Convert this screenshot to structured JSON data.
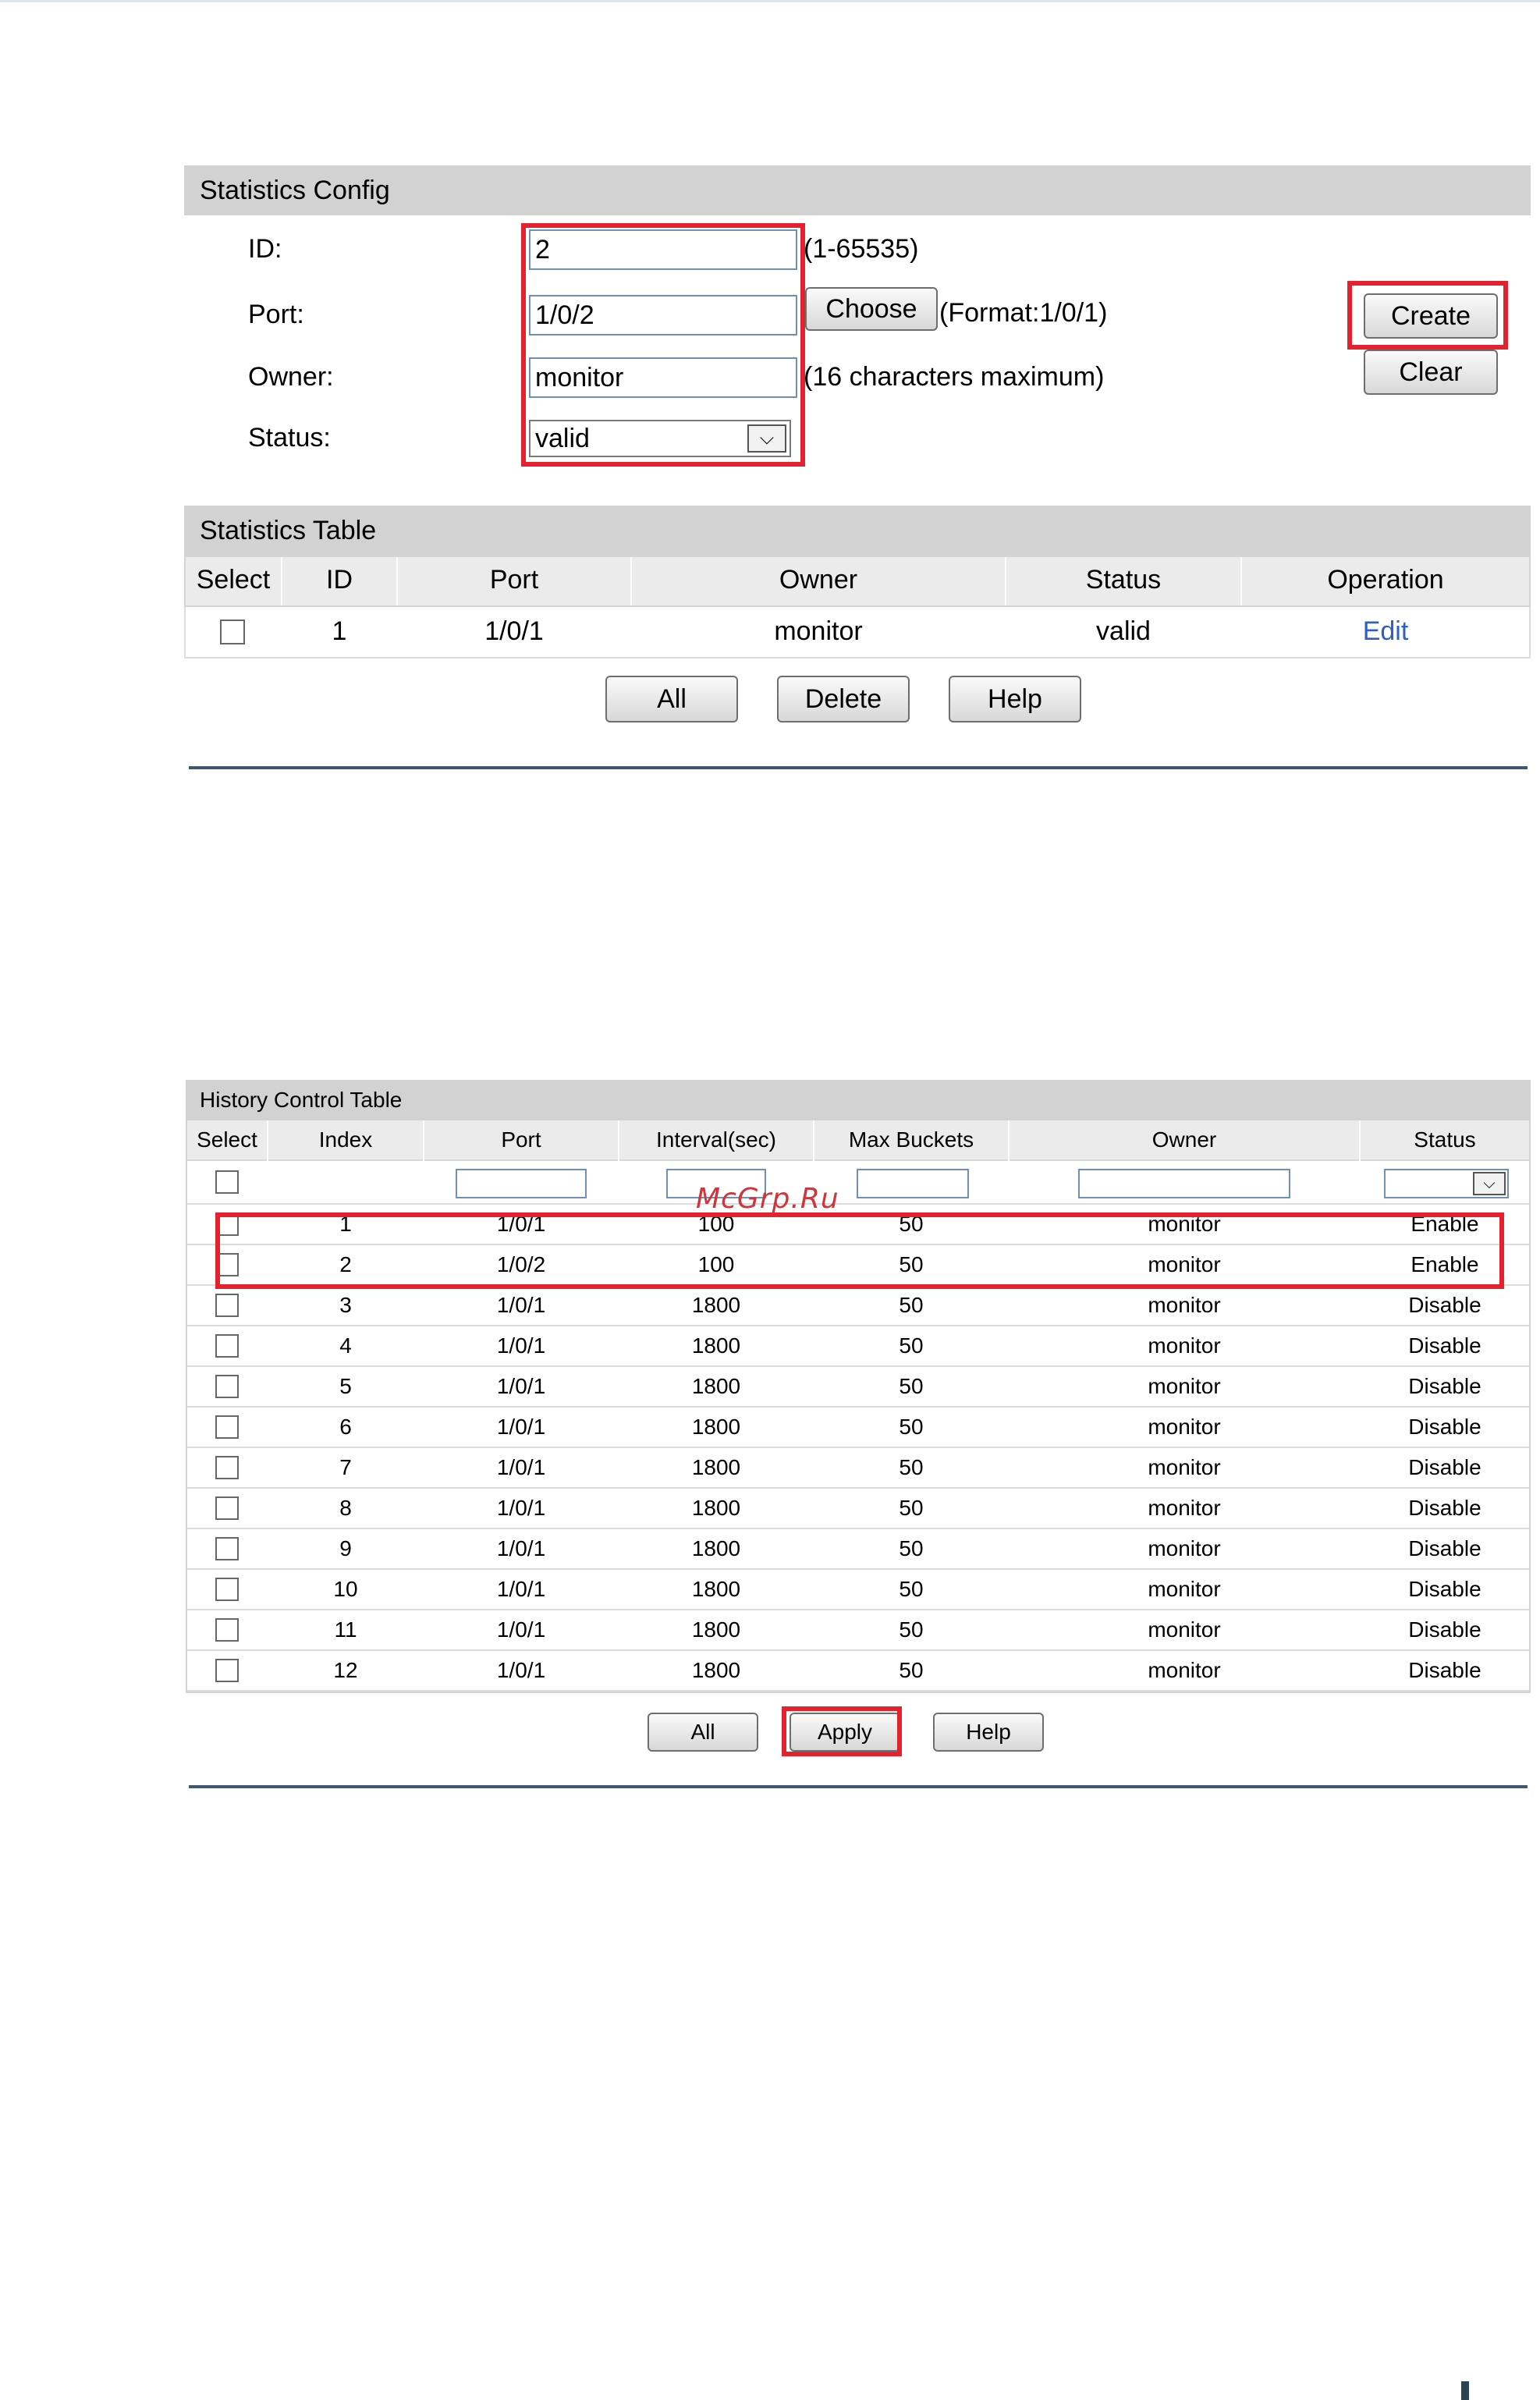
{
  "statistics_config": {
    "header": "Statistics Config",
    "id_label": "ID:",
    "id_value": "2",
    "id_hint": "(1-65535)",
    "port_label": "Port:",
    "port_value": "1/0/2",
    "choose_label": "Choose",
    "port_hint": "(Format:1/0/1)",
    "owner_label": "Owner:",
    "owner_value": "monitor",
    "owner_hint": "(16 characters maximum)",
    "status_label": "Status:",
    "status_value": "valid",
    "create_label": "Create",
    "clear_label": "Clear"
  },
  "statistics_table": {
    "header": "Statistics Table",
    "columns": [
      "Select",
      "ID",
      "Port",
      "Owner",
      "Status",
      "Operation"
    ],
    "rows": [
      {
        "id": "1",
        "port": "1/0/1",
        "owner": "monitor",
        "status": "valid",
        "operation": "Edit"
      }
    ],
    "buttons": {
      "all": "All",
      "delete": "Delete",
      "help": "Help"
    }
  },
  "history_control_table": {
    "header": "History Control Table",
    "columns": [
      "Select",
      "Index",
      "Port",
      "Interval(sec)",
      "Max Buckets",
      "Owner",
      "Status"
    ],
    "rows": [
      {
        "index": "1",
        "port": "1/0/1",
        "interval": "100",
        "buckets": "50",
        "owner": "monitor",
        "status": "Enable"
      },
      {
        "index": "2",
        "port": "1/0/2",
        "interval": "100",
        "buckets": "50",
        "owner": "monitor",
        "status": "Enable"
      },
      {
        "index": "3",
        "port": "1/0/1",
        "interval": "1800",
        "buckets": "50",
        "owner": "monitor",
        "status": "Disable"
      },
      {
        "index": "4",
        "port": "1/0/1",
        "interval": "1800",
        "buckets": "50",
        "owner": "monitor",
        "status": "Disable"
      },
      {
        "index": "5",
        "port": "1/0/1",
        "interval": "1800",
        "buckets": "50",
        "owner": "monitor",
        "status": "Disable"
      },
      {
        "index": "6",
        "port": "1/0/1",
        "interval": "1800",
        "buckets": "50",
        "owner": "monitor",
        "status": "Disable"
      },
      {
        "index": "7",
        "port": "1/0/1",
        "interval": "1800",
        "buckets": "50",
        "owner": "monitor",
        "status": "Disable"
      },
      {
        "index": "8",
        "port": "1/0/1",
        "interval": "1800",
        "buckets": "50",
        "owner": "monitor",
        "status": "Disable"
      },
      {
        "index": "9",
        "port": "1/0/1",
        "interval": "1800",
        "buckets": "50",
        "owner": "monitor",
        "status": "Disable"
      },
      {
        "index": "10",
        "port": "1/0/1",
        "interval": "1800",
        "buckets": "50",
        "owner": "monitor",
        "status": "Disable"
      },
      {
        "index": "11",
        "port": "1/0/1",
        "interval": "1800",
        "buckets": "50",
        "owner": "monitor",
        "status": "Disable"
      },
      {
        "index": "12",
        "port": "1/0/1",
        "interval": "1800",
        "buckets": "50",
        "owner": "monitor",
        "status": "Disable"
      }
    ],
    "buttons": {
      "all": "All",
      "apply": "Apply",
      "help": "Help"
    }
  },
  "watermark": "McGrp.Ru",
  "icons": {
    "select_arrow": "chevron-down-icon"
  },
  "colors": {
    "highlight": "#e4222e",
    "link": "#2e5fc4",
    "header_bg": "#d2d2d2"
  }
}
